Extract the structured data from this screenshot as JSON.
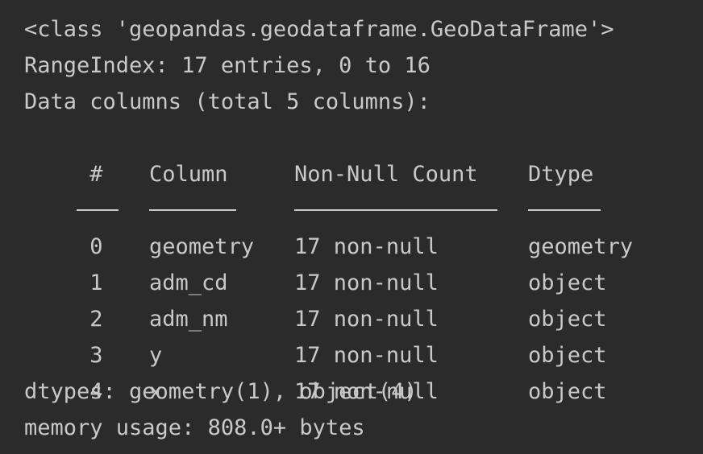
{
  "header": {
    "class_line": "<class 'geopandas.geodataframe.GeoDataFrame'>",
    "range_line": "RangeIndex: 17 entries, 0 to 16",
    "columns_line": "Data columns (total 5 columns):"
  },
  "table": {
    "headers": {
      "num": " #",
      "column": "Column",
      "non_null": "Non-Null Count",
      "dtype": "Dtype"
    },
    "separators": {
      "num": "---",
      "column": "------",
      "non_null": "--------------",
      "dtype": "-----"
    },
    "rows": [
      {
        "num": " 0",
        "column": "geometry",
        "non_null": "17 non-null",
        "dtype": "geometry"
      },
      {
        "num": " 1",
        "column": "adm_cd",
        "non_null": "17 non-null",
        "dtype": "object"
      },
      {
        "num": " 2",
        "column": "adm_nm",
        "non_null": "17 non-null",
        "dtype": "object"
      },
      {
        "num": " 3",
        "column": "y",
        "non_null": "17 non-null",
        "dtype": "object"
      },
      {
        "num": " 4",
        "column": "x",
        "non_null": "17 non-null",
        "dtype": "object"
      }
    ]
  },
  "footer": {
    "dtypes_line": "dtypes: geometry(1), object(4)",
    "memory_line": "memory usage: 808.0+ bytes"
  }
}
